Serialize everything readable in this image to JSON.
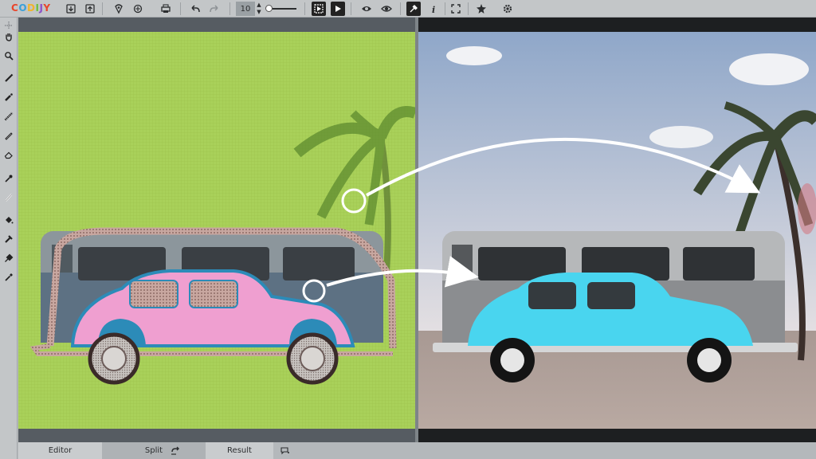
{
  "app": {
    "logo_text": "CODIJY",
    "logo_colors": [
      "#e8462c",
      "#3aa0d8",
      "#f1b42c",
      "#6cbf3c",
      "#8b4fc8",
      "#e8462c"
    ]
  },
  "toolbar": {
    "brush_size": "10",
    "buttons": [
      {
        "name": "open-icon"
      },
      {
        "name": "export-icon"
      },
      {
        "name": "save-icon"
      },
      {
        "name": "colorize-icon"
      },
      {
        "name": "print-icon"
      },
      {
        "name": "undo-icon"
      },
      {
        "name": "redo-icon"
      },
      {
        "name": "preview-mode-icon"
      },
      {
        "name": "play-icon"
      },
      {
        "name": "show-strokes-icon"
      },
      {
        "name": "show-masks-icon"
      },
      {
        "name": "color-picker-icon"
      },
      {
        "name": "info-icon"
      },
      {
        "name": "fit-screen-icon"
      },
      {
        "name": "settings-icon"
      },
      {
        "name": "gear-icon"
      }
    ]
  },
  "tools": [
    "move-icon",
    "hand-icon",
    "zoom-icon",
    "pencil-icon",
    "marker-icon",
    "dashed-brush-icon",
    "outline-brush-icon",
    "eraser-icon",
    "dropper-icon",
    "line-icon",
    "fill-icon",
    "stamp-icon",
    "swap-icon",
    "eyedropper-icon"
  ],
  "tabs": {
    "editor": "Editor",
    "split": "Split",
    "result": "Result"
  },
  "colors": {
    "editor_background": "#a7cf52",
    "car_editor": "#ef9fd0",
    "car_result": "#49d5ef",
    "stroke_outline": "#2c8bb8",
    "van_body": "#9aa1a6",
    "sky": "#c8d4e6"
  }
}
